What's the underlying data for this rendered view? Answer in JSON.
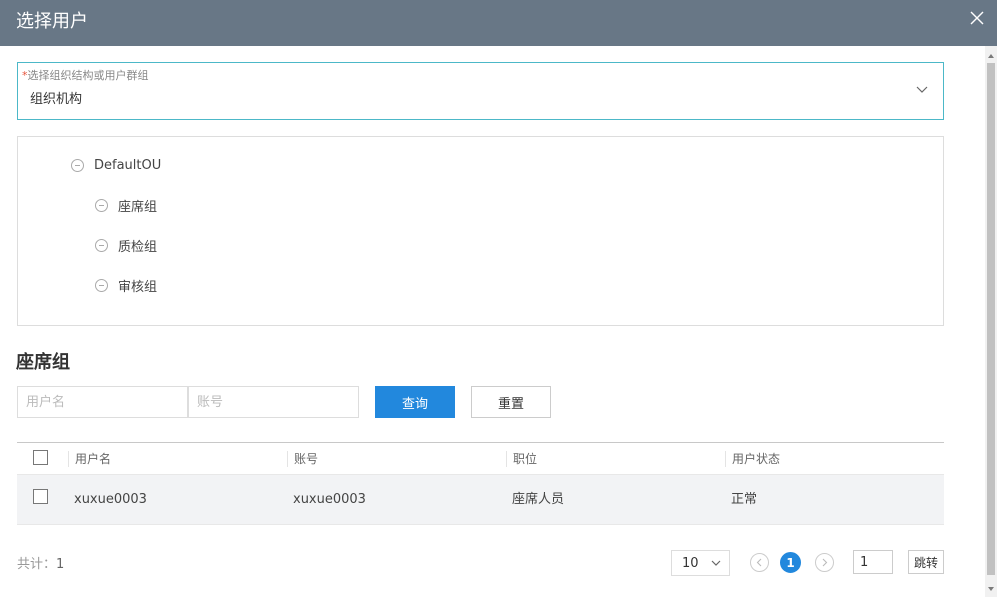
{
  "dialog": {
    "title": "选择用户"
  },
  "org_select": {
    "required_mark": "*",
    "label": "选择组织结构或用户群组",
    "value": "组织机构"
  },
  "tree": {
    "root": "DefaultOU",
    "children": [
      "座席组",
      "质检组",
      "审核组"
    ]
  },
  "section": {
    "title": "座席组"
  },
  "search": {
    "username_placeholder": "用户名",
    "account_placeholder": "账号",
    "query_label": "查询",
    "reset_label": "重置"
  },
  "table": {
    "columns": [
      "用户名",
      "账号",
      "职位",
      "用户状态"
    ],
    "rows": [
      {
        "username": "xuxue0003",
        "account": "xuxue0003",
        "position": "座席人员",
        "status": "正常"
      }
    ]
  },
  "pagination": {
    "total_label": "共计：",
    "total": "1",
    "page_size": "10",
    "current_page": "1",
    "jump_value": "1",
    "jump_label": "跳转"
  },
  "colors": {
    "titlebar": "#687786",
    "primary": "#2288dd",
    "select_border": "#4cb8c8"
  }
}
